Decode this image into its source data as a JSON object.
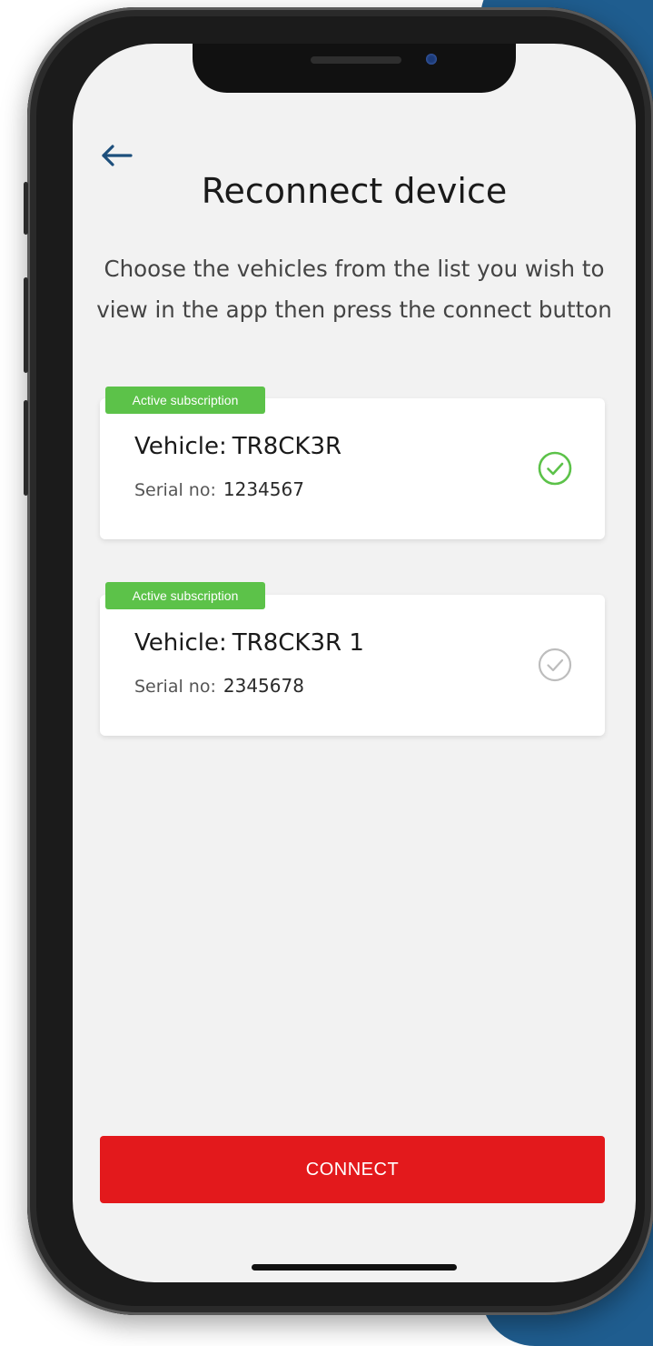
{
  "header": {
    "back_icon": "arrow-left-icon",
    "title": "Reconnect device",
    "subtitle": "Choose the vehicles from the list you wish to view in the app then press the connect button"
  },
  "vehicles": [
    {
      "badge": "Active subscription",
      "vehicle_label": "Vehicle:",
      "vehicle_name": "TR8CK3R",
      "serial_label": "Serial no:",
      "serial_value": "1234567",
      "selected": true,
      "check_icon": "check-circle-icon"
    },
    {
      "badge": "Active subscription",
      "vehicle_label": "Vehicle:",
      "vehicle_name": "TR8CK3R 1",
      "serial_label": "Serial no:",
      "serial_value": "2345678",
      "selected": false,
      "check_icon": "check-circle-icon"
    }
  ],
  "actions": {
    "connect_label": "CONNECT"
  },
  "colors": {
    "accent_green": "#5cc249",
    "connect_red": "#e3191c",
    "back_arrow_blue": "#1d4f7c",
    "unselected_gray": "#bdbdbd"
  }
}
